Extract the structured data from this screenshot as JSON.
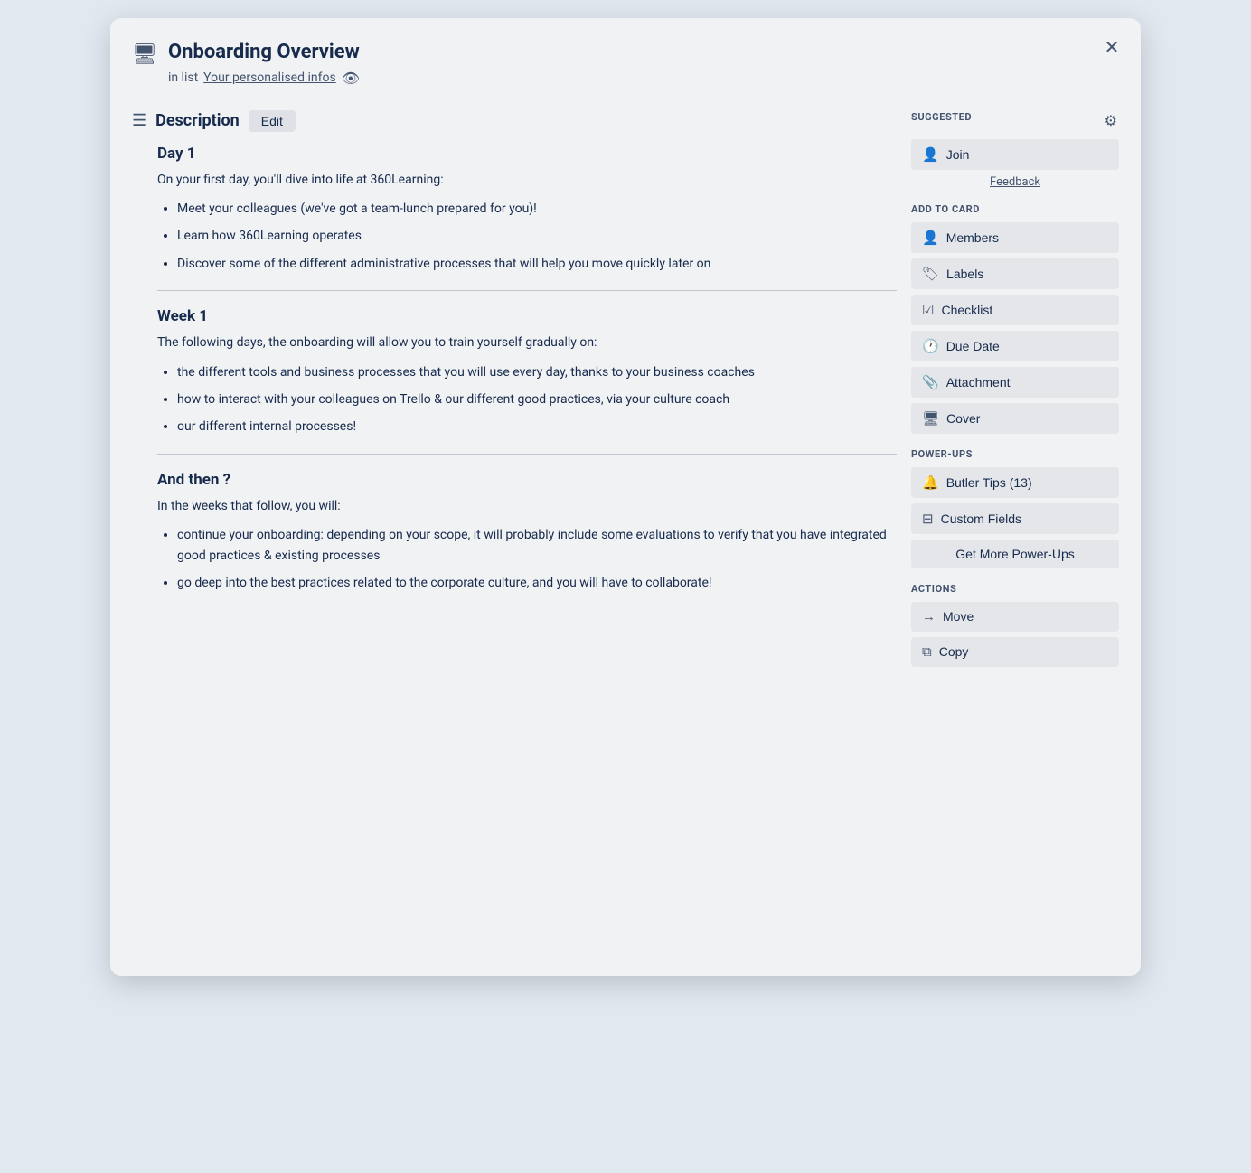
{
  "modal": {
    "title": "Onboarding Overview",
    "subtitle_prefix": "in list",
    "list_name": "Your personalised infos",
    "close_label": "✕"
  },
  "description": {
    "section_title": "Description",
    "edit_label": "Edit",
    "sections": [
      {
        "heading": "Day 1",
        "intro": "On your first day, you'll dive into life at 360Learning:",
        "bullets": [
          "Meet your colleagues (we've got a team-lunch prepared for you)!",
          "Learn how 360Learning operates",
          "Discover some of the different administrative processes that will help you move quickly later on"
        ]
      },
      {
        "heading": "Week 1",
        "intro": "The following days, the onboarding will allow you to train yourself gradually on:",
        "bullets": [
          "the different tools and business processes that you will use every day, thanks to your business coaches",
          "how to interact with your colleagues on Trello & our different good practices, via your culture coach",
          "our different internal processes!"
        ]
      },
      {
        "heading": "And then ?",
        "intro": "In the weeks that follow, you will:",
        "bullets": [
          "continue your onboarding: depending on your scope, it will probably include some evaluations to verify that you have integrated good practices & existing processes",
          "go deep into the best practices related to the corporate culture, and you will have to collaborate!"
        ]
      }
    ]
  },
  "sidebar": {
    "suggested_label": "SUGGESTED",
    "join_label": "Join",
    "feedback_label": "Feedback",
    "add_to_card_label": "ADD TO CARD",
    "members_label": "Members",
    "labels_label": "Labels",
    "checklist_label": "Checklist",
    "due_date_label": "Due Date",
    "attachment_label": "Attachment",
    "cover_label": "Cover",
    "power_ups_label": "POWER-UPS",
    "butler_tips_label": "Butler Tips (13)",
    "custom_fields_label": "Custom Fields",
    "get_more_label": "Get More Power-Ups",
    "actions_label": "ACTIONS",
    "move_label": "Move",
    "copy_label": "Copy"
  }
}
